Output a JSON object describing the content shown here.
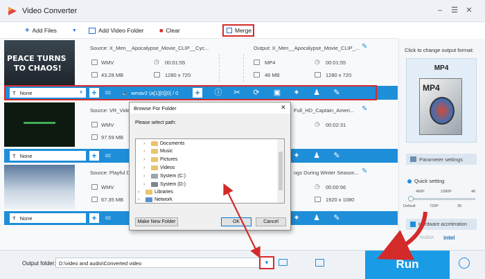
{
  "window": {
    "title": "Video Converter"
  },
  "toolbar": {
    "add_files": "Add Files",
    "add_video_folder": "Add Video Folder",
    "clear": "Clear",
    "merge": "Merge"
  },
  "items": [
    {
      "source": "Source: X_Men__Apocalypse_Movie_CLIP__Cyc...",
      "output": "Output: X_Men__Apocalypse_Movie_CLIP_...",
      "src_format": "WMV",
      "src_duration": "00:01:55",
      "src_size": "43.28 MB",
      "src_res": "1280 x 720",
      "out_format": "MP4",
      "out_duration": "00:01:55",
      "out_size": "46 MB",
      "out_res": "1280 x 720",
      "thumb_text_1": "PEACE TURNS",
      "thumb_text_2": "TO CHAOS!",
      "subtitle": "None",
      "audio": "wmav2 (a[1][0][0] / 0"
    },
    {
      "source": "Source: VR_Vide",
      "output": "Full_HD_Captain_Ameri...",
      "src_format": "WMV",
      "src_size": "97.59 MB",
      "out_duration": "00:02:31",
      "subtitle": "None"
    },
    {
      "source": "Source: Playful D",
      "output": "ogs During Winter Season...",
      "src_format": "WMV",
      "src_size": "67.35 MB",
      "out_duration": "00:00:56",
      "out_res": "1920 x 1080",
      "subtitle": "None"
    }
  ],
  "right_panel": {
    "click_label": "Click to change output format:",
    "format": "MP4",
    "format_icon_text": "MP4",
    "param_settings": "Parameter settings",
    "quick_setting": "Quick setting",
    "scale_top": [
      "480P",
      "1080P",
      "4K"
    ],
    "scale_bottom": [
      "Default",
      "720P",
      "2K"
    ],
    "hw_accel": "Hardware acceleration",
    "nvidia": "NVIDIA",
    "intel": "intel"
  },
  "bottom": {
    "output_label": "Output folder:",
    "output_path": "D:\\video and audio\\Converted video",
    "run": "Run"
  },
  "dialog": {
    "title": "Browse For Folder",
    "prompt": "Please select path:",
    "tree": [
      "Documents",
      "Music",
      "Pictures",
      "Videos",
      "System (C:)",
      "System (D:)",
      "Libraries",
      "Network"
    ],
    "make_new_folder": "Make New Folder",
    "ok": "OK",
    "cancel": "Cancel"
  },
  "colors": {
    "accent": "#1f8ed8",
    "run": "#1a9be6",
    "highlight": "#d42a2a"
  }
}
